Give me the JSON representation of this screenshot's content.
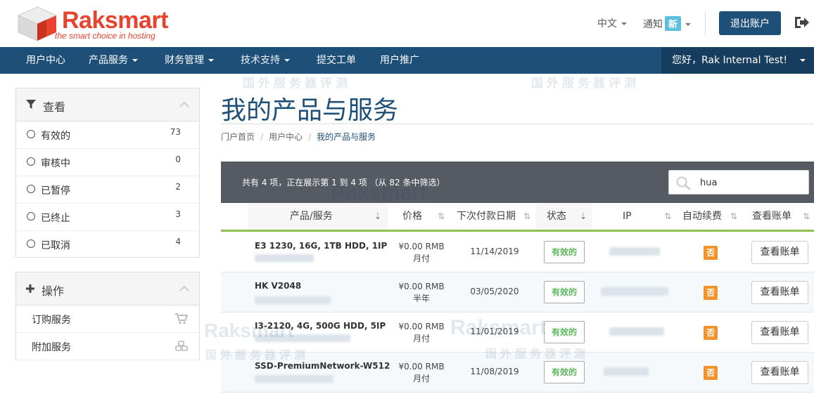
{
  "brand": {
    "name": "Raksmart",
    "tagline": "the smart choice in hosting"
  },
  "header": {
    "language": "中文",
    "notice_label": "通知",
    "notice_badge": "新",
    "logout": "退出账户"
  },
  "nav": {
    "items": [
      {
        "label": "用户中心"
      },
      {
        "label": "产品服务"
      },
      {
        "label": "财务管理"
      },
      {
        "label": "技术支持"
      },
      {
        "label": "提交工单"
      },
      {
        "label": "用户推广"
      }
    ],
    "greeting": "您好，Rak Internal Test!"
  },
  "filter_panel": {
    "title": "查看",
    "items": [
      {
        "label": "有效的",
        "count": "73"
      },
      {
        "label": "审核中",
        "count": "0"
      },
      {
        "label": "已暂停",
        "count": "2"
      },
      {
        "label": "已终止",
        "count": "3"
      },
      {
        "label": "已取消",
        "count": "4"
      }
    ]
  },
  "actions_panel": {
    "title": "操作",
    "items": [
      {
        "label": "订购服务",
        "icon": "cart-icon"
      },
      {
        "label": "附加服务",
        "icon": "cubes-icon"
      }
    ]
  },
  "page": {
    "title": "我的产品与服务",
    "breadcrumb": [
      "门户首页",
      "用户中心",
      "我的产品与服务"
    ]
  },
  "table": {
    "info": "共有 4 项，正在展示第 1 到 4 项 （从 82 条中筛选）",
    "search_value": "hua",
    "columns": [
      "产品/服务",
      "价格",
      "下次付款日期",
      "状态",
      "IP",
      "自动续费",
      "查看账单"
    ],
    "rows": [
      {
        "product": "E3 1230, 16G, 1TB HDD, 1IP",
        "price": "¥0.00 RMB",
        "cycle": "月付",
        "date": "11/14/2019",
        "status": "有效的",
        "autorenew": "否",
        "action": "查看账单"
      },
      {
        "product": "HK V2048",
        "price": "¥0.00 RMB",
        "cycle": "半年",
        "date": "03/05/2020",
        "status": "有效的",
        "autorenew": "否",
        "action": "查看账单"
      },
      {
        "product": "I3-2120, 4G, 500G HDD, 5IP",
        "price": "¥0.00 RMB",
        "cycle": "月付",
        "date": "11/01/2019",
        "status": "有效的",
        "autorenew": "否",
        "action": "查看账单"
      },
      {
        "product": "SSD-PremiumNetwork-W512",
        "price": "¥0.00 RMB",
        "cycle": "月付",
        "date": "11/08/2019",
        "status": "有效的",
        "autorenew": "否",
        "action": "查看账单"
      }
    ]
  },
  "watermark": {
    "brand": "Raksmart",
    "text": "国外服务器评测"
  },
  "colors": {
    "primary": "#1e4f79",
    "accent": "#e8432f",
    "success": "#5cb85c",
    "warning": "#f0932b",
    "table_header": "#555a63"
  }
}
